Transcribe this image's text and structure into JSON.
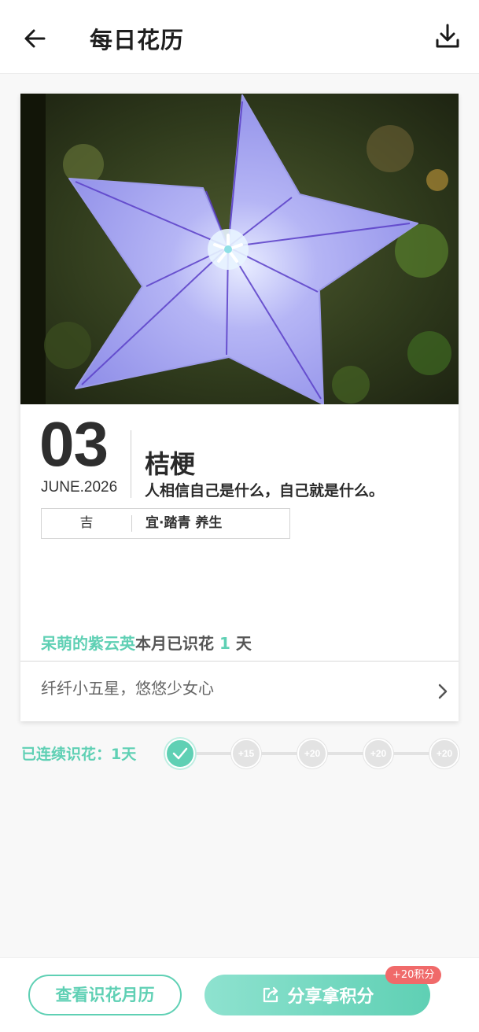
{
  "header": {
    "title": "每日花历",
    "back_icon": "arrow-left-icon",
    "download_icon": "download-icon"
  },
  "card": {
    "photo_subject": "purple balloon flower",
    "day": "03",
    "month_year": "JUNE.2026",
    "flower_name": "桔梗",
    "quote": "人相信自己是什么，自己就是什么。",
    "fortune": {
      "luck": "吉",
      "suitable": "宜·踏青 养生"
    },
    "streak": {
      "nickname": "呆萌的紫云英",
      "text_before": "本月已识花",
      "count": "1",
      "text_after": "天"
    },
    "motto": "纤纤小五星，悠悠少女心"
  },
  "checkin": {
    "label": "已连续识花：1天",
    "nodes": [
      {
        "label": "",
        "done": true
      },
      {
        "label": "+15",
        "done": false
      },
      {
        "label": "+20",
        "done": false
      },
      {
        "label": "+20",
        "done": false
      },
      {
        "label": "+20",
        "done": false
      }
    ]
  },
  "bottom": {
    "calendar_button": "查看识花月历",
    "share_button": "分享拿积分",
    "points_badge": "+20积分"
  },
  "colors": {
    "accent": "#5fd0b4",
    "badge": "#f06a6a"
  }
}
